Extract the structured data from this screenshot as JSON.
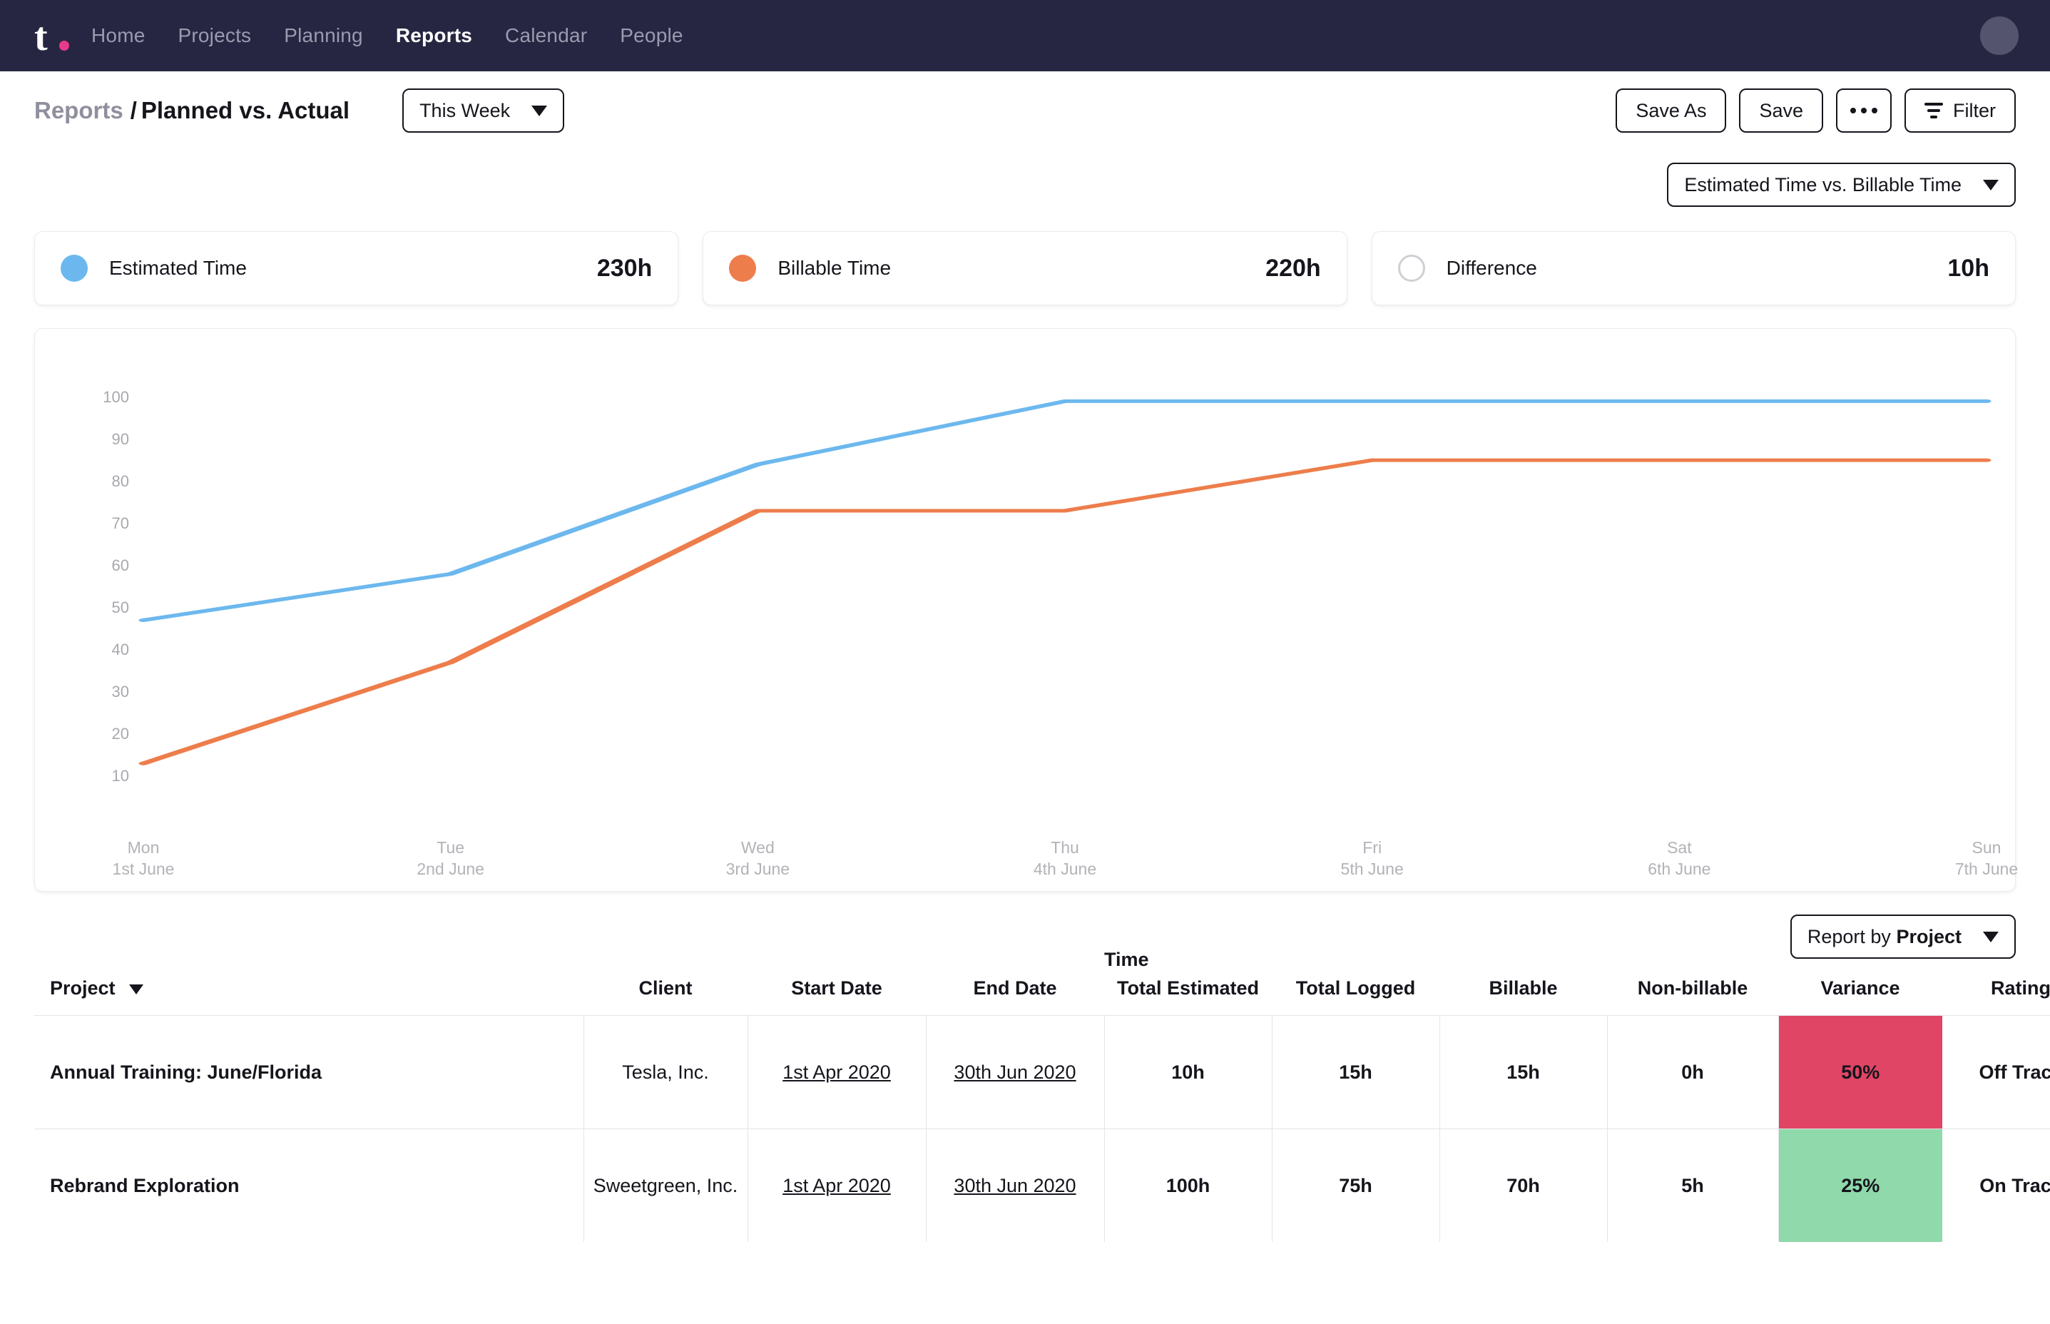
{
  "topnav": {
    "logo_letter": "t",
    "items": [
      {
        "label": "Home",
        "active": false
      },
      {
        "label": "Projects",
        "active": false
      },
      {
        "label": "Planning",
        "active": false
      },
      {
        "label": "Reports",
        "active": true
      },
      {
        "label": "Calendar",
        "active": false
      },
      {
        "label": "People",
        "active": false
      }
    ]
  },
  "header": {
    "breadcrumb_parent": "Reports",
    "breadcrumb_sep": "/",
    "breadcrumb_current": "Planned vs. Actual",
    "period_select": "This Week",
    "save_as_label": "Save As",
    "save_label": "Save",
    "filter_label": "Filter"
  },
  "metric_select": {
    "label": "Estimated Time vs. Billable Time"
  },
  "cards": [
    {
      "label": "Estimated Time",
      "value": "230h",
      "color": "#6cb8ee",
      "hollow": false
    },
    {
      "label": "Billable Time",
      "value": "220h",
      "color": "#ed7d4b",
      "hollow": false
    },
    {
      "label": "Difference",
      "value": "10h",
      "color": "#cfcfd4",
      "hollow": true
    }
  ],
  "chart_data": {
    "type": "line",
    "title": "",
    "xlabel": "",
    "ylabel": "",
    "ylim": [
      0,
      105
    ],
    "yticks": [
      100,
      90,
      80,
      70,
      60,
      50,
      40,
      30,
      20,
      10
    ],
    "grid": false,
    "legend_position": "above-chart-cards",
    "categories": [
      "Mon",
      "Tue",
      "Wed",
      "Thu",
      "Fri",
      "Sat",
      "Sun"
    ],
    "x_sublabels": [
      "1st June",
      "2nd June",
      "3rd June",
      "4th June",
      "5th June",
      "6th June",
      "7th June"
    ],
    "series": [
      {
        "name": "Estimated Time",
        "color": "#6cb8ee",
        "values": [
          47,
          58,
          84,
          99,
          99,
          99,
          99
        ]
      },
      {
        "name": "Billable Time",
        "color": "#ed7d4b",
        "values": [
          13,
          37,
          73,
          73,
          85,
          85,
          85
        ]
      }
    ]
  },
  "report_by": {
    "prefix": "Report by",
    "value": "Project"
  },
  "table": {
    "headers": {
      "project": "Project",
      "client": "Client",
      "start_date": "Start Date",
      "end_date": "End Date",
      "time_group": "Time",
      "total_estimated": "Total Estimated",
      "total_logged": "Total Logged",
      "billable": "Billable",
      "non_billable": "Non-billable",
      "variance": "Variance",
      "rating": "Rating",
      "settings_icon": "gear-icon"
    },
    "rows": [
      {
        "project": "Annual Training: June/Florida",
        "client": "Tesla, Inc.",
        "start_date": "1st Apr 2020",
        "end_date": "30th Jun 2020",
        "total_estimated": "10h",
        "total_logged": "15h",
        "billable": "15h",
        "non_billable": "0h",
        "variance": "50%",
        "variance_color": "#e04566",
        "rating": "Off Track"
      },
      {
        "project": "Rebrand Exploration",
        "client": "Sweetgreen, Inc.",
        "start_date": "1st Apr 2020",
        "end_date": "30th Jun 2020",
        "total_estimated": "100h",
        "total_logged": "75h",
        "billable": "70h",
        "non_billable": "5h",
        "variance": "25%",
        "variance_color": "#8fd9ab",
        "rating": "On Track"
      }
    ]
  }
}
